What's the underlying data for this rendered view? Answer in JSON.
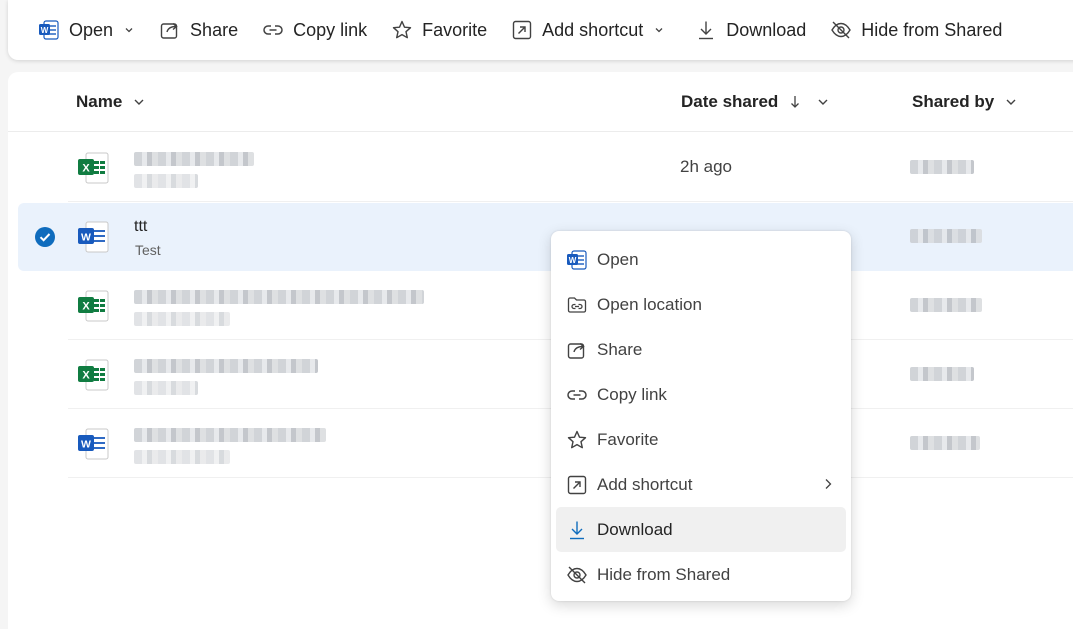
{
  "toolbar": {
    "open": "Open",
    "share": "Share",
    "copy_link": "Copy link",
    "favorite": "Favorite",
    "add_shortcut": "Add shortcut",
    "download": "Download",
    "hide_from_shared": "Hide from Shared"
  },
  "columns": {
    "name": "Name",
    "date_shared": "Date shared",
    "shared_by": "Shared by"
  },
  "files": [
    {
      "type": "excel",
      "name": "",
      "sub": "",
      "date": "2h ago"
    },
    {
      "type": "word",
      "name": "ttt",
      "sub": "Test",
      "date": "",
      "selected": true
    },
    {
      "type": "excel",
      "name": "",
      "sub": "",
      "date": ""
    },
    {
      "type": "excel",
      "name": "",
      "sub": "",
      "date": ""
    },
    {
      "type": "word",
      "name": "",
      "sub": "",
      "date": ""
    }
  ],
  "context_menu": {
    "open": "Open",
    "open_location": "Open location",
    "share": "Share",
    "copy_link": "Copy link",
    "favorite": "Favorite",
    "add_shortcut": "Add shortcut",
    "download": "Download",
    "hide_from_shared": "Hide from Shared"
  },
  "colors": {
    "accent": "#0f6cbd",
    "word_blue": "#185abd",
    "excel_green": "#107c41",
    "selected_row": "#eaf2fc"
  }
}
